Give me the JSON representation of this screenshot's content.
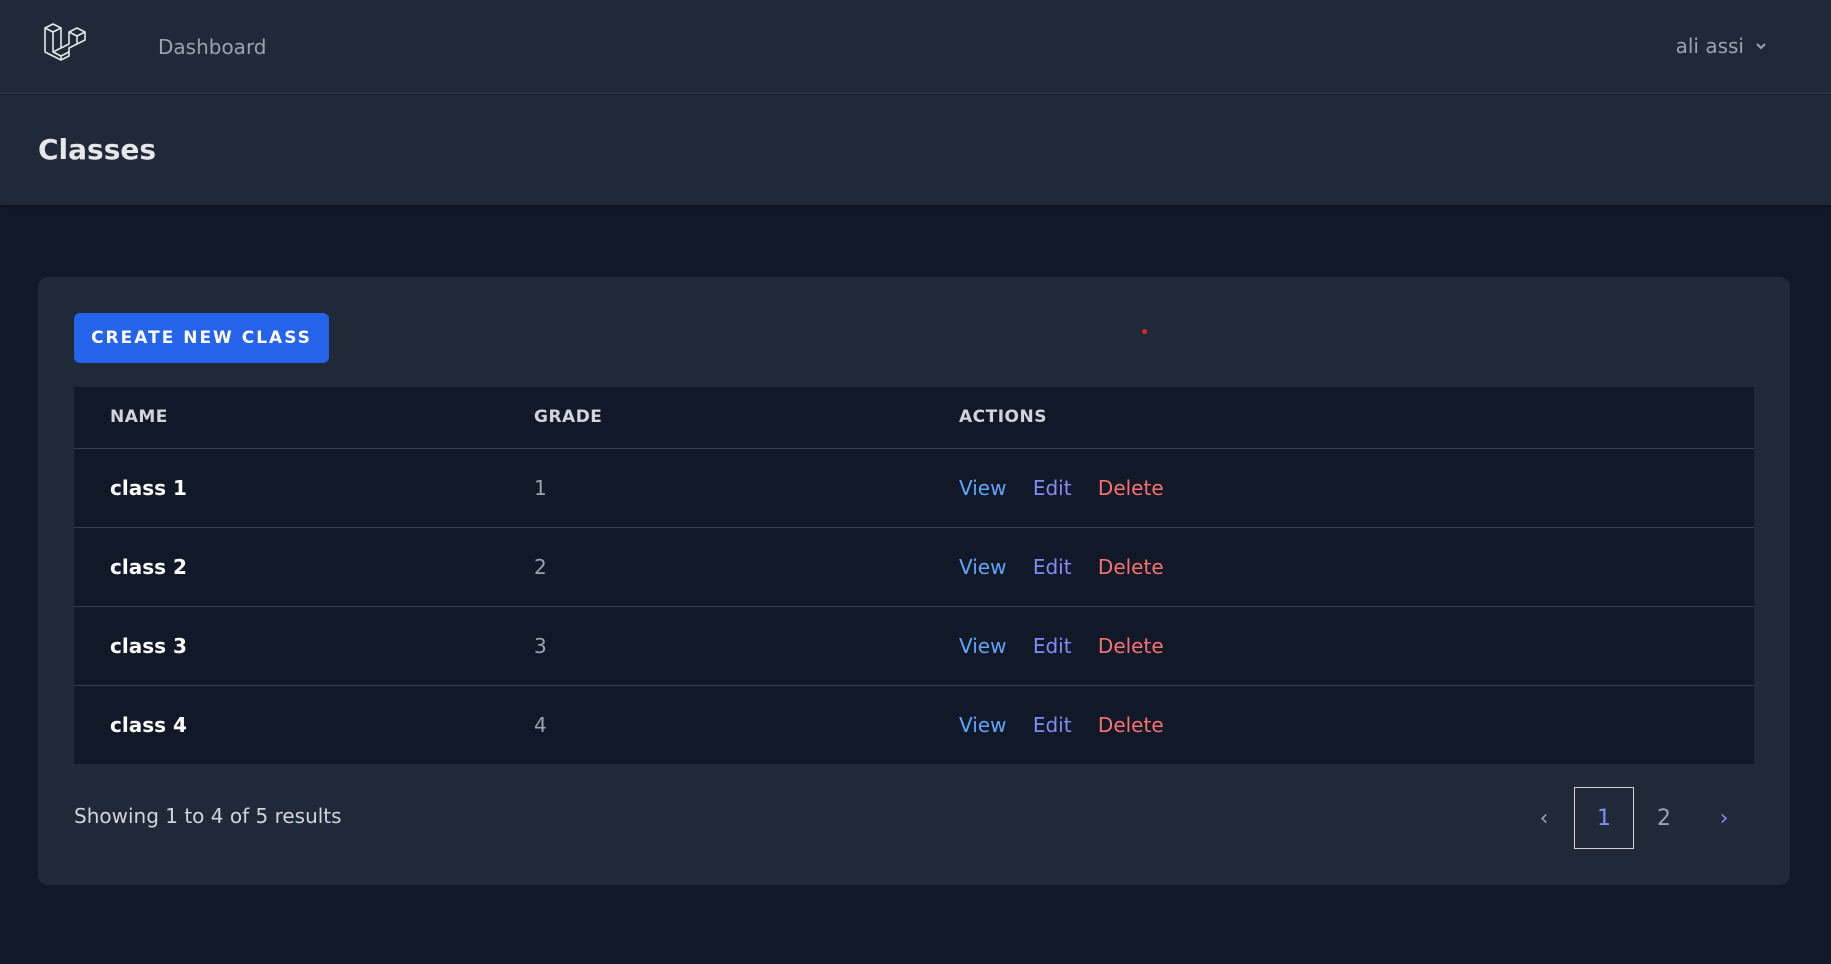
{
  "nav": {
    "dashboard_label": "Dashboard",
    "user_name": "ali assi"
  },
  "header": {
    "title": "Classes"
  },
  "toolbar": {
    "create_label": "CREATE NEW CLASS"
  },
  "table": {
    "columns": [
      "NAME",
      "GRADE",
      "ACTIONS"
    ],
    "rows": [
      {
        "name": "class 1",
        "grade": "1",
        "view": "View",
        "edit": "Edit",
        "delete": "Delete"
      },
      {
        "name": "class 2",
        "grade": "2",
        "view": "View",
        "edit": "Edit",
        "delete": "Delete"
      },
      {
        "name": "class 3",
        "grade": "3",
        "view": "View",
        "edit": "Edit",
        "delete": "Delete"
      },
      {
        "name": "class 4",
        "grade": "4",
        "view": "View",
        "edit": "Edit",
        "delete": "Delete"
      }
    ]
  },
  "pagination": {
    "summary": "Showing 1 to 4 of 5 results",
    "prev": "‹",
    "pages": [
      "1",
      "2"
    ],
    "current": "1",
    "next": "›"
  },
  "colors": {
    "primary": "#2563eb",
    "view_link": "#60a5fa",
    "edit_link": "#818cf8",
    "delete_link": "#f87171"
  },
  "icons": {
    "logo": "laravel-logo-icon",
    "user_dropdown": "chevron-down-icon"
  }
}
